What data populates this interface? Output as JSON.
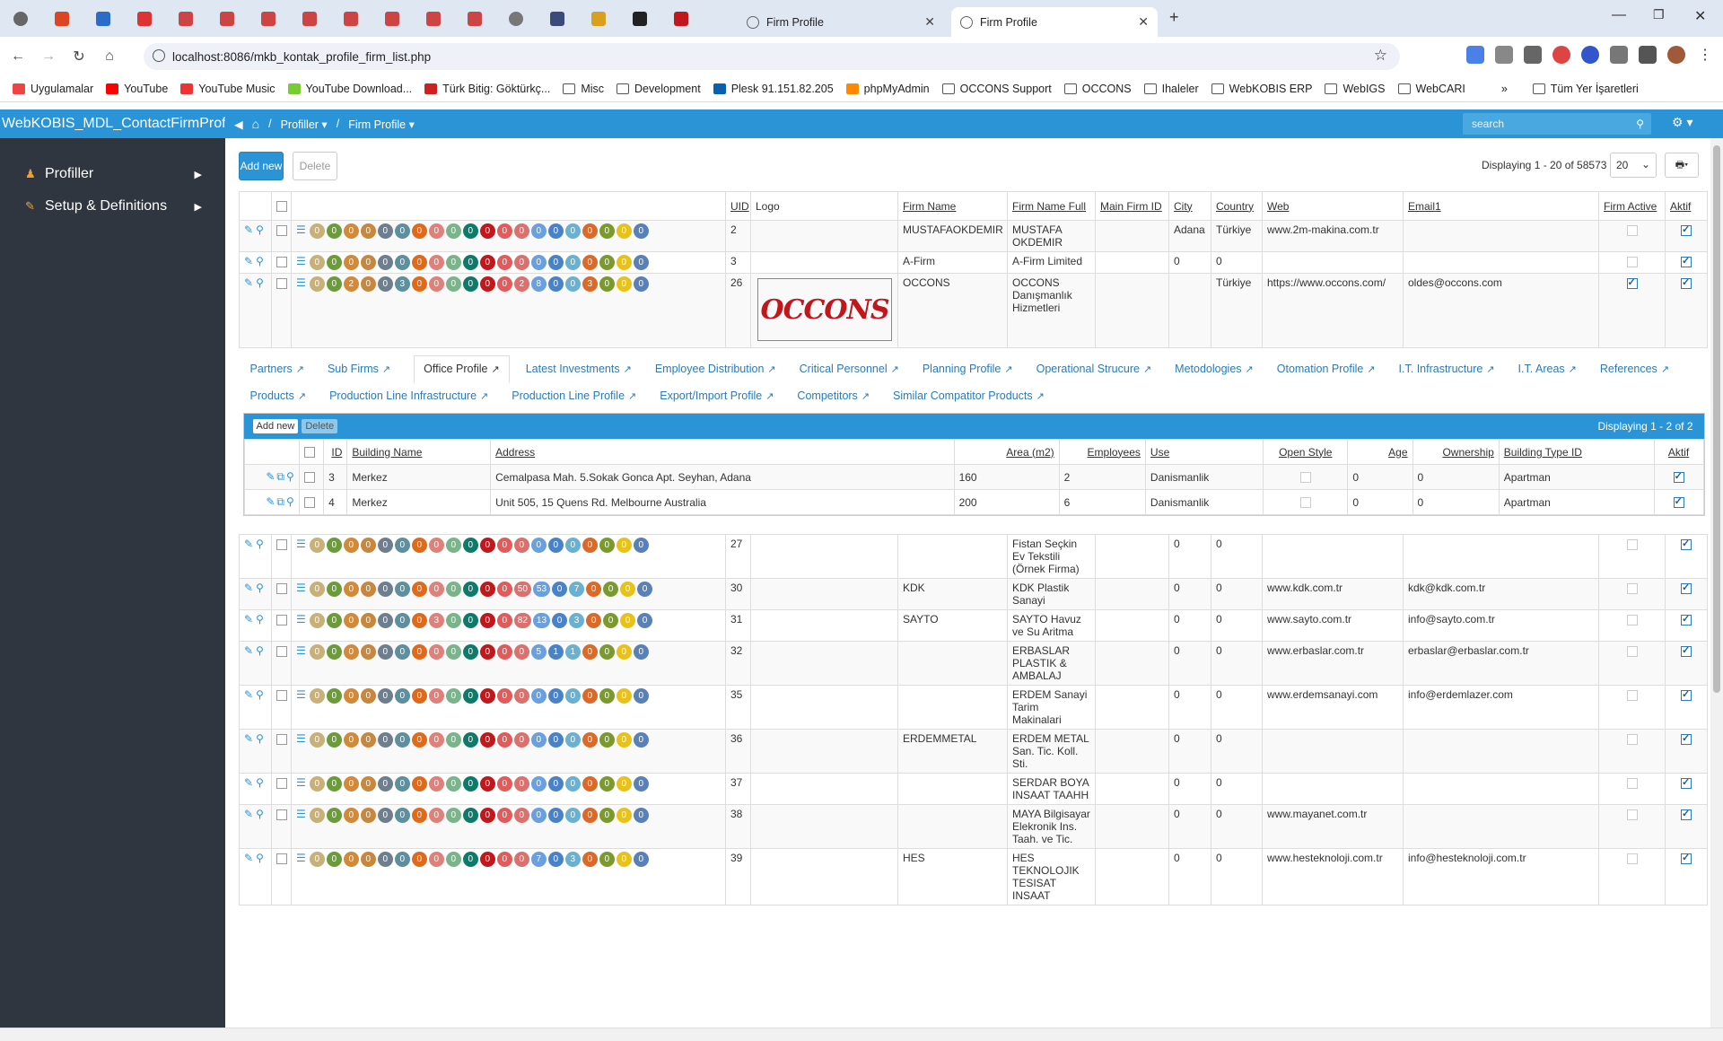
{
  "browser": {
    "tabs": [
      {
        "title": "Firm Profile",
        "active": false
      },
      {
        "title": "Firm Profile",
        "active": true
      }
    ],
    "url": "localhost:8086/mkb_kontak_profile_firm_list.php",
    "bookmarks": [
      "Uygulamalar",
      "YouTube",
      "YouTube Music",
      "YouTube Download...",
      "Türk Bitig: Göktürkç...",
      "Misc",
      "Development",
      "Plesk 91.151.82.205",
      "phpMyAdmin",
      "OCCONS Support",
      "OCCONS",
      "Ihaleler",
      "WebKOBIS ERP",
      "WebIGS",
      "WebCARI"
    ],
    "bookmarks_more": "»",
    "bookmarks_all": "Tüm Yer İşaretleri"
  },
  "app": {
    "brand": "WebKOBIS_MDL_ContactFirmProfile",
    "menu": [
      {
        "label": "Profiller"
      },
      {
        "label": "Setup & Definitions"
      }
    ],
    "breadcrumb": {
      "profiller": "Profiller",
      "firm_profile": "Firm Profile"
    },
    "search_placeholder": "search"
  },
  "toolbar": {
    "add_new": "Add new",
    "delete": "Delete",
    "displaying": "Displaying 1 - 20 of 58573",
    "page_size": "20"
  },
  "columns": {
    "uid": "UID",
    "logo": "Logo",
    "firm_name": "Firm Name",
    "firm_name_full": "Firm Name Full",
    "main_firm_id": "Main Firm ID",
    "city": "City",
    "country": "Country",
    "web": "Web",
    "email1": "Email1",
    "firm_active": "Firm Active",
    "aktif": "Aktif"
  },
  "badge_colors": [
    "#c8b07a",
    "#6b9b3a",
    "#d08a3a",
    "#c8873e",
    "#6e7e8e",
    "#5d8f9e",
    "#e06a1c",
    "#e0807a",
    "#7bb38a",
    "#0f7a6a",
    "#c0181c",
    "#e25b5b",
    "#d9726e",
    "#6a9fe0",
    "#4a82c8",
    "#6ab0d0",
    "#d96a2a",
    "#7a9a2e",
    "#e8c21a",
    "#5a80b8"
  ],
  "rows": [
    {
      "uid": "2",
      "badges": [
        "0",
        "0",
        "0",
        "0",
        "0",
        "0",
        "0",
        "0",
        "0",
        "0",
        "0",
        "0",
        "0",
        "0",
        "0",
        "0",
        "0",
        "0",
        "0",
        "0"
      ],
      "firm_name": "MUSTAFAOKDEMIR",
      "firm_name_full": "MUSTAFA OKDEMIR",
      "main_firm_id": "",
      "city": "Adana",
      "country": "Türkiye",
      "web": "www.2m-makina.com.tr",
      "email1": "",
      "firm_active": false,
      "aktif": true
    },
    {
      "uid": "3",
      "badges": [
        "0",
        "0",
        "0",
        "0",
        "0",
        "0",
        "0",
        "0",
        "0",
        "0",
        "0",
        "0",
        "0",
        "0",
        "0",
        "0",
        "0",
        "0",
        "0",
        "0"
      ],
      "firm_name": "A-Firm",
      "firm_name_full": "A-Firm Limited",
      "main_firm_id": "",
      "city": "0",
      "country": "0",
      "web": "",
      "email1": "",
      "firm_active": false,
      "aktif": true
    },
    {
      "uid": "26",
      "badges": [
        "0",
        "0",
        "2",
        "0",
        "0",
        "3",
        "0",
        "0",
        "0",
        "0",
        "0",
        "0",
        "2",
        "8",
        "0",
        "0",
        "3",
        "0",
        "0",
        "0"
      ],
      "logo_text": "OCCONS",
      "firm_name": "OCCONS",
      "firm_name_full": "OCCONS Danışmanlık Hizmetleri",
      "main_firm_id": "",
      "city": "",
      "country": "Türkiye",
      "web": "https://www.occons.com/",
      "email1": "oldes@occons.com",
      "firm_active": true,
      "aktif": true
    }
  ],
  "detail": {
    "tabs": [
      "Partners",
      "Sub Firms",
      "Office Profile",
      "Latest Investments",
      "Employee Distribution",
      "Critical Personnel",
      "Planning Profile",
      "Operational Strucure",
      "Metodologies",
      "Otomation Profile",
      "I.T. Infrastructure",
      "I.T. Areas",
      "References",
      "Products",
      "Production Line Infrastructure",
      "Production Line Profile",
      "Export/Import Profile",
      "Competitors",
      "Similar Compatitor Products"
    ],
    "active_tab": "Office Profile",
    "add_new": "Add new",
    "delete": "Delete",
    "displaying": "Displaying 1 - 2 of 2",
    "columns": {
      "id": "ID",
      "building_name": "Building Name",
      "address": "Address",
      "area": "Area (m2)",
      "employees": "Employees",
      "use": "Use",
      "open_style": "Open Style",
      "age": "Age",
      "ownership": "Ownership",
      "building_type": "Building Type ID",
      "aktif": "Aktif"
    },
    "rows": [
      {
        "id": "3",
        "building_name": "Merkez",
        "address": "Cemalpasa Mah. 5.Sokak Gonca Apt. Seyhan, Adana",
        "area": "160",
        "employees": "2",
        "use": "Danismanlik",
        "age": "0",
        "ownership": "0",
        "building_type": "Apartman"
      },
      {
        "id": "4",
        "building_name": "Merkez",
        "address": "Unit 505, 15 Quens Rd. Melbourne Australia",
        "area": "200",
        "employees": "6",
        "use": "Danismanlik",
        "age": "0",
        "ownership": "0",
        "building_type": "Apartman"
      }
    ]
  },
  "rows2": [
    {
      "uid": "27",
      "badges": [
        "0",
        "0",
        "0",
        "0",
        "0",
        "0",
        "0",
        "0",
        "0",
        "0",
        "0",
        "0",
        "0",
        "0",
        "0",
        "0",
        "0",
        "0",
        "0",
        "0"
      ],
      "firm_name": "",
      "firm_name_full": "Fistan Seçkin Ev Tekstili (Örnek Firma)",
      "city": "0",
      "country": "0",
      "web": "",
      "email1": "",
      "firm_active": false,
      "aktif": true
    },
    {
      "uid": "30",
      "badges": [
        "0",
        "0",
        "0",
        "0",
        "0",
        "0",
        "0",
        "0",
        "0",
        "0",
        "0",
        "0",
        "50",
        "53",
        "0",
        "7",
        "0",
        "0",
        "0",
        "0"
      ],
      "firm_name": "KDK",
      "firm_name_full": "KDK Plastik Sanayi",
      "city": "0",
      "country": "0",
      "web": "www.kdk.com.tr",
      "email1": "kdk@kdk.com.tr",
      "firm_active": false,
      "aktif": true
    },
    {
      "uid": "31",
      "badges": [
        "0",
        "0",
        "0",
        "0",
        "0",
        "0",
        "0",
        "3",
        "0",
        "0",
        "0",
        "0",
        "82",
        "13",
        "0",
        "3",
        "0",
        "0",
        "0",
        "0"
      ],
      "firm_name": "SAYTO",
      "firm_name_full": "SAYTO Havuz ve Su Aritma",
      "city": "0",
      "country": "0",
      "web": "www.sayto.com.tr",
      "email1": "info@sayto.com.tr",
      "firm_active": false,
      "aktif": true
    },
    {
      "uid": "32",
      "badges": [
        "0",
        "0",
        "0",
        "0",
        "0",
        "0",
        "0",
        "0",
        "0",
        "0",
        "0",
        "0",
        "0",
        "5",
        "1",
        "1",
        "0",
        "0",
        "0",
        "0"
      ],
      "firm_name": "",
      "firm_name_full": "ERBASLAR PLASTIK & AMBALAJ",
      "city": "0",
      "country": "0",
      "web": "www.erbaslar.com.tr",
      "email1": "erbaslar@erbaslar.com.tr",
      "firm_active": false,
      "aktif": true
    },
    {
      "uid": "35",
      "badges": [
        "0",
        "0",
        "0",
        "0",
        "0",
        "0",
        "0",
        "0",
        "0",
        "0",
        "0",
        "0",
        "0",
        "0",
        "0",
        "0",
        "0",
        "0",
        "0",
        "0"
      ],
      "firm_name": "",
      "firm_name_full": "ERDEM Sanayi Tarim Makinalari",
      "city": "0",
      "country": "0",
      "web": "www.erdemsanayi.com",
      "email1": "info@erdemlazer.com",
      "firm_active": false,
      "aktif": true
    },
    {
      "uid": "36",
      "badges": [
        "0",
        "0",
        "0",
        "0",
        "0",
        "0",
        "0",
        "0",
        "0",
        "0",
        "0",
        "0",
        "0",
        "0",
        "0",
        "0",
        "0",
        "0",
        "0",
        "0"
      ],
      "firm_name": "ERDEMMETAL",
      "firm_name_full": "ERDEM METAL San. Tic. Koll. Sti.",
      "city": "0",
      "country": "0",
      "web": "",
      "email1": "",
      "firm_active": false,
      "aktif": true
    },
    {
      "uid": "37",
      "badges": [
        "0",
        "0",
        "0",
        "0",
        "0",
        "0",
        "0",
        "0",
        "0",
        "0",
        "0",
        "0",
        "0",
        "0",
        "0",
        "0",
        "0",
        "0",
        "0",
        "0"
      ],
      "firm_name": "",
      "firm_name_full": "SERDAR BOYA INSAAT TAAHH",
      "city": "0",
      "country": "0",
      "web": "",
      "email1": "",
      "firm_active": false,
      "aktif": true
    },
    {
      "uid": "38",
      "badges": [
        "0",
        "0",
        "0",
        "0",
        "0",
        "0",
        "0",
        "0",
        "0",
        "0",
        "0",
        "0",
        "0",
        "0",
        "0",
        "0",
        "0",
        "0",
        "0",
        "0"
      ],
      "firm_name": "",
      "firm_name_full": "MAYA Bilgisayar Elekronik Ins. Taah. ve Tic.",
      "city": "0",
      "country": "0",
      "web": "www.mayanet.com.tr",
      "email1": "",
      "firm_active": false,
      "aktif": true
    },
    {
      "uid": "39",
      "badges": [
        "0",
        "0",
        "0",
        "0",
        "0",
        "0",
        "0",
        "0",
        "0",
        "0",
        "0",
        "0",
        "0",
        "7",
        "0",
        "3",
        "0",
        "0",
        "0",
        "0"
      ],
      "firm_name": "HES",
      "firm_name_full": "HES TEKNOLOJIK TESISAT INSAAT",
      "city": "0",
      "country": "0",
      "web": "www.hesteknoloji.com.tr",
      "email1": "info@hesteknoloji.com.tr",
      "firm_active": false,
      "aktif": true
    }
  ]
}
